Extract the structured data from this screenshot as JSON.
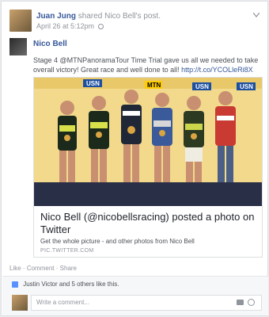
{
  "post": {
    "author": "Juan Jung",
    "action": "shared",
    "shared_owner": "Nico Bell's",
    "post_word": "post.",
    "date": "April 26 at 5:12pm"
  },
  "shared_post": {
    "author": "Nico Bell",
    "text": "Stage 4 @MTNPanoramaTour Time Trial gave us all we needed to take overall victory! Great race and well done to all!",
    "link": "http://t.co/YCOLleRi8X"
  },
  "link_card": {
    "title": "Nico Bell (@nicobellsracing) posted a photo on Twitter",
    "description": "Get the whole picture - and other photos from Nico Bell",
    "domain": "PIC.TWITTER.COM"
  },
  "actions": {
    "like": "Like",
    "comment": "Comment",
    "share": "Share",
    "separator": "·"
  },
  "likes_text": "Justin Victor and 5 others like this.",
  "comment_placeholder": "Write a comment...",
  "colors": {
    "link": "#365899",
    "muted": "#90949c",
    "photo_bg": "#f1d88b"
  },
  "photo_banner_words": [
    "USN",
    "MTN",
    "USN",
    "USN"
  ]
}
